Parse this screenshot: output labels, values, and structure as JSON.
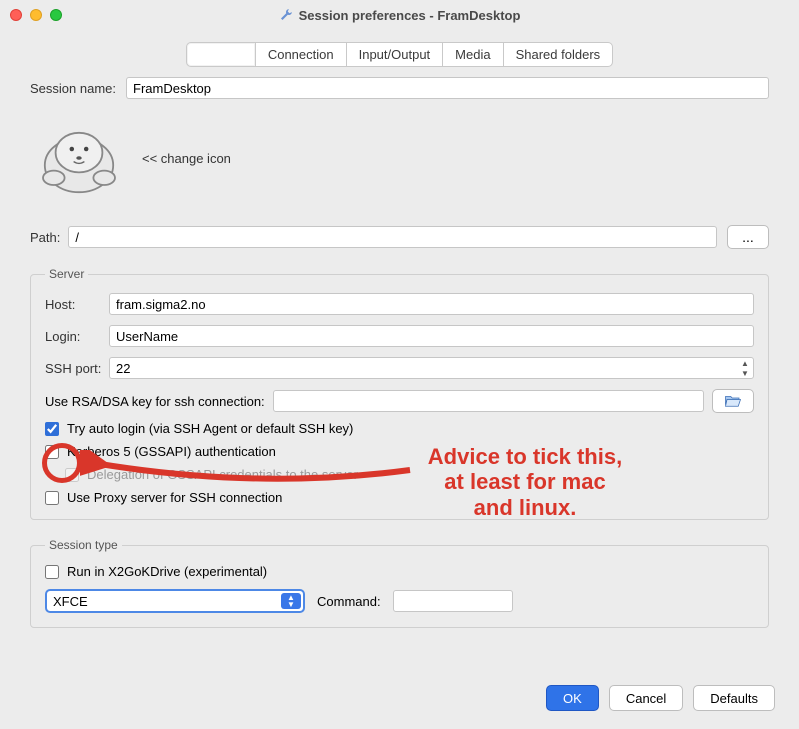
{
  "window": {
    "title": "Session preferences - FramDesktop"
  },
  "tabs": {
    "items": [
      "",
      "Connection",
      "Input/Output",
      "Media",
      "Shared folders"
    ]
  },
  "session_name": {
    "label": "Session name:",
    "value": "FramDesktop"
  },
  "change_icon": "<< change icon",
  "path": {
    "label": "Path:",
    "value": "/",
    "browse": "..."
  },
  "server": {
    "legend": "Server",
    "host_label": "Host:",
    "host": "fram.sigma2.no",
    "login_label": "Login:",
    "login": "UserName",
    "sshport_label": "SSH port:",
    "sshport": "22",
    "rsa_label": "Use RSA/DSA key for ssh connection:",
    "auto_login": "Try auto login (via SSH Agent or default SSH key)",
    "kerberos": "Kerberos 5 (GSSAPI) authentication",
    "delegation": "Delegation of GSSAPI credentials to the server",
    "proxy": "Use Proxy server for SSH connection"
  },
  "session_type": {
    "legend": "Session type",
    "kdrive": "Run in X2GoKDrive (experimental)",
    "selected": "XFCE",
    "command_label": "Command:",
    "command": ""
  },
  "footer": {
    "ok": "OK",
    "cancel": "Cancel",
    "defaults": "Defaults"
  },
  "annotation": {
    "text_l1": "Advice to tick this,",
    "text_l2": "at least for mac",
    "text_l3": "and linux."
  }
}
